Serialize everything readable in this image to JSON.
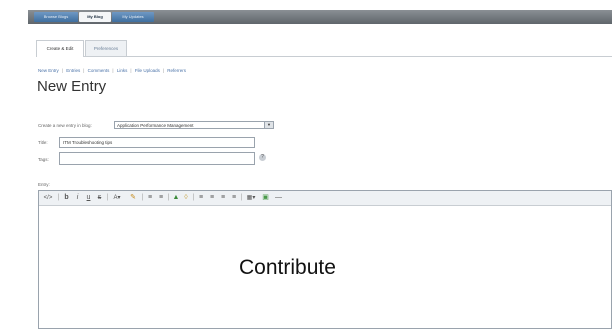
{
  "nav": {
    "tabs": [
      "Browse Blogs",
      "My Blog",
      "My Updates"
    ],
    "active": "My Blog"
  },
  "subtabs": [
    "Create & Edit",
    "Preferences"
  ],
  "links": [
    "New Entry",
    "Entries",
    "Comments",
    "Links",
    "File Uploads",
    "Referrers"
  ],
  "page_title": "New Entry",
  "form": {
    "blog_label": "Create a new entry in blog:",
    "blog_value": "Application Performance Management",
    "title_label": "Title:",
    "title_value": "ITM Troubleshooting tips",
    "tags_label": "Tags:",
    "tags_value": "",
    "help_glyph": "?",
    "entry_label": "Entry:"
  },
  "toolbar_icons": [
    "source-icon",
    "bold-icon",
    "italic-icon",
    "underline-icon",
    "strikethrough-icon",
    "font-size-icon",
    "text-color-icon",
    "numbered-list-icon",
    "bulleted-list-icon",
    "link-icon",
    "unlink-icon",
    "align-left-icon",
    "align-center-icon",
    "align-right-icon",
    "justify-icon",
    "table-icon",
    "image-icon",
    "horizontal-rule-icon"
  ],
  "overlay_caption": "Contribute",
  "colors": {
    "nav_tab": "#3f6f9f",
    "link": "#4a72a8",
    "border": "#9aa3ad"
  }
}
